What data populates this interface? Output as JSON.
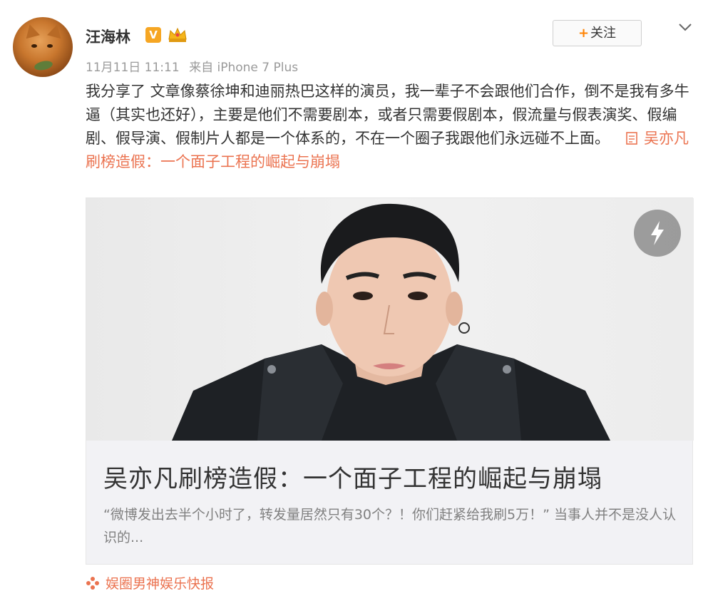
{
  "user": {
    "name": "汪海林",
    "verified_badge": "V",
    "timestamp": "11月11日 11:11",
    "source": "来自 iPhone 7 Plus"
  },
  "actions": {
    "follow_plus": "+",
    "follow_label": "关注",
    "more_icon": "chevron-down-icon"
  },
  "post": {
    "text": "我分享了 文章像蔡徐坤和迪丽热巴这样的演员，我一辈子不会跟他们合作，倒不是我有多牛逼（其实也还好），主要是他们不需要剧本，或者只需要假剧本，假流量与假表演奖、假编剧、假导演、假制片人都是一个体系的，不在一个圈子我跟他们永远碰不上面。",
    "link_text": "吴亦凡刷榜造假：一个面子工程的崛起与崩塌"
  },
  "card": {
    "title": "吴亦凡刷榜造假：一个面子工程的崛起与崩塌",
    "description": "“微博发出去半个小时了，转发量居然只有30个？！你们赶紧给我刷5万！” 当事人并不是没人认识的..."
  },
  "footer": {
    "source_name": "娱圈男神娱乐快报"
  },
  "colors": {
    "link": "#eb7350",
    "accent": "#ff8200",
    "meta": "#9a9a9a",
    "card_bg": "#f2f2f5"
  }
}
